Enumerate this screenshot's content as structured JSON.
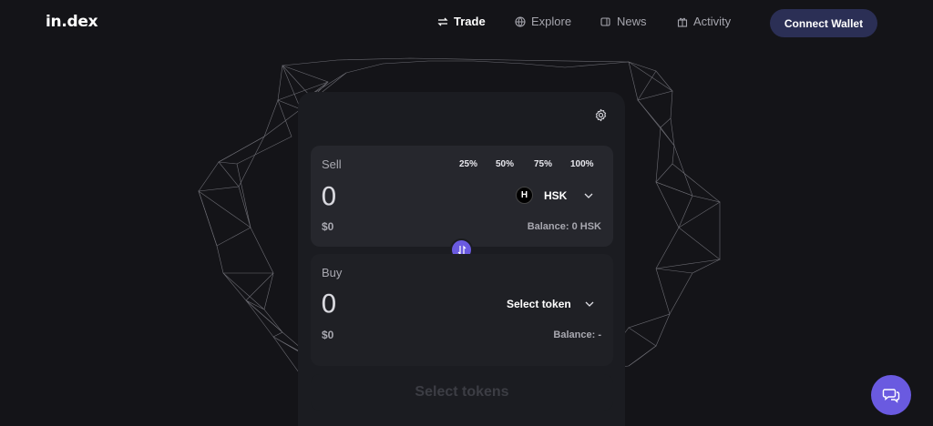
{
  "brand": {
    "logo": "in.dex"
  },
  "nav": {
    "trade": "Trade",
    "explore": "Explore",
    "news": "News",
    "activity": "Activity",
    "connect": "Connect Wallet"
  },
  "sell": {
    "label": "Sell",
    "percents": [
      "25%",
      "50%",
      "75%",
      "100%"
    ],
    "amount": "0",
    "usd": "$0",
    "token_symbol": "HSK",
    "token_icon_letter": "H",
    "balance": "Balance: 0 HSK"
  },
  "buy": {
    "label": "Buy",
    "amount": "0",
    "usd": "$0",
    "token_select": "Select token",
    "balance": "Balance: -"
  },
  "action": {
    "label": "Select tokens"
  },
  "colors": {
    "background": "#141418",
    "accent": "#6a5ae0",
    "connect_button": "#2b2f55"
  }
}
